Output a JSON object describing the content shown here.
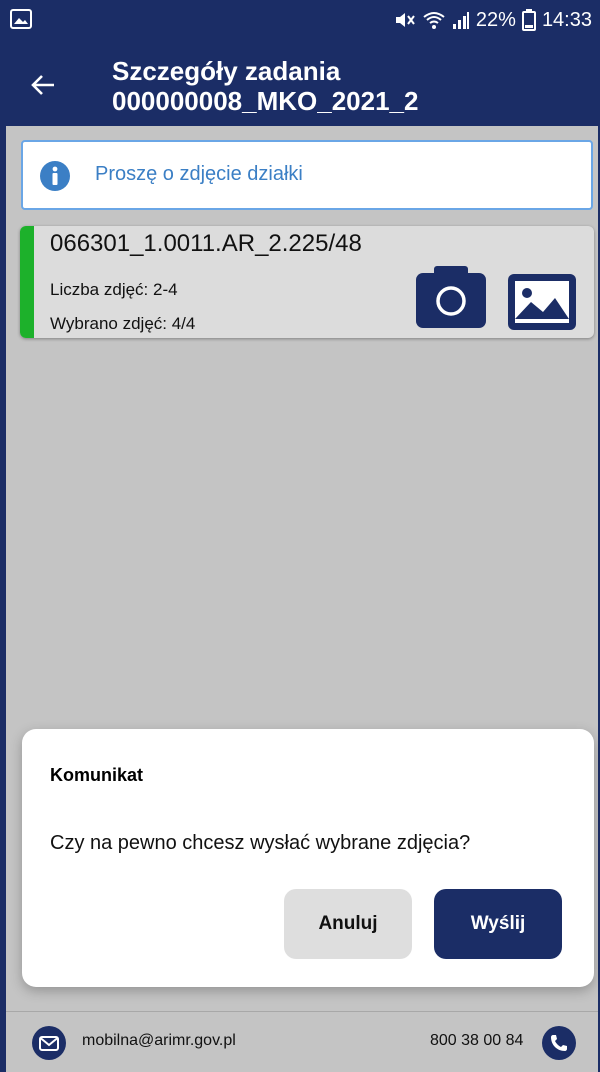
{
  "status_bar": {
    "battery": "22%",
    "time": "14:33"
  },
  "app_bar": {
    "title_line1": "Szczegóły zadania",
    "title_line2": "000000008_MKO_2021_2"
  },
  "info": {
    "text": "Proszę o zdjęcie działki"
  },
  "card": {
    "title": "066301_1.0011.AR_2.225/48",
    "photo_count": "Liczba zdjęć: 2-4",
    "selected": "Wybrano zdjęć: 4/4"
  },
  "dialog": {
    "title": "Komunikat",
    "message": "Czy na pewno chcesz wysłać wybrane zdjęcia?",
    "cancel_label": "Anuluj",
    "send_label": "Wyślij"
  },
  "footer": {
    "email": "mobilna@arimr.gov.pl",
    "phone": "800 38 00 84"
  },
  "colors": {
    "primary": "#1b2d66",
    "status_ok": "#1db12b",
    "info_blue": "#3b7fc5"
  },
  "icons": [
    "image-icon",
    "mute-icon",
    "wifi-icon",
    "signal-icon",
    "battery-icon",
    "back-arrow-icon",
    "info-icon",
    "camera-icon",
    "gallery-icon",
    "mail-icon",
    "phone-icon"
  ]
}
